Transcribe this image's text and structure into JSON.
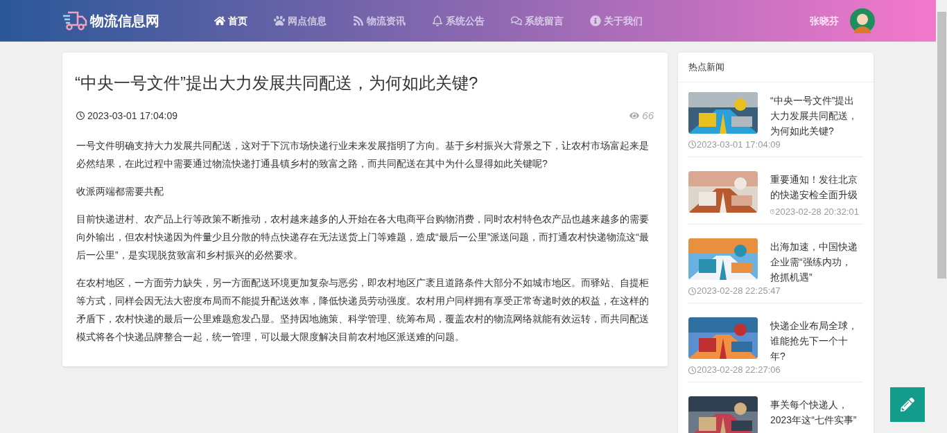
{
  "header": {
    "logo": "物流信息网",
    "nav": [
      {
        "label": "首页",
        "selected": true
      },
      {
        "label": "网点信息",
        "selected": false
      },
      {
        "label": "物流资讯",
        "selected": false
      },
      {
        "label": "系统公告",
        "selected": false
      },
      {
        "label": "系统留言",
        "selected": false
      },
      {
        "label": "关于我们",
        "selected": false
      }
    ],
    "user": "张晓芬"
  },
  "article": {
    "title": "“中央一号文件”提出大力发展共同配送，为何如此关键?",
    "date": "2023-03-01 17:04:09",
    "views": "66",
    "paragraphs": [
      "一号文件明确支持大力发展共同配送，这对于下沉市场快递行业未来发展指明了方向。基于乡村振兴大背景之下，让农村市场富起来是必然结果，在此过程中需要通过物流快递打通县镇乡村的致富之路，而共同配送在其中为什么显得如此关键呢?",
      "收派两端都需要共配",
      "目前快递进村、农产品上行等政策不断推动，农村越来越多的人开始在各大电商平台购物消费，同时农村特色农产品也越来越多的需要向外输出，但农村快递因为件量少且分散的特点快递存在无法送货上门等难题，造成“最后一公里”派送问题，而打通农村快递物流这“最后一公里”，是实现脱贫致富和乡村振兴的必然要求。",
      "在农村地区，一方面劳力缺失，另一方面配送环境更加复杂与恶劣，即农村地区广袤且道路条件大部分不如城市地区。而驿站、自提柜等方式，同样会因无法大密度布局而不能提升配送效率，降低快递员劳动强度。农村用户同样拥有享受正常寄递时效的权益，在这样的矛盾下，农村快递的最后一公里难题愈发凸显。坚持因地施策、科学管理、统筹布局，覆盖农村的物流网络就能有效运转，而共同配送模式将各个快递品牌整合一起，统一管理，可以最大限度解决目前农村地区派送难的问题。"
    ]
  },
  "hot_news": {
    "title": "热点新闻",
    "items": [
      {
        "title": "“中央一号文件”提出大力发展共同配送，为何如此关键?",
        "date": "2023-03-01 17:04:09",
        "kind": "date-below"
      },
      {
        "title": "重要通知！发往北京的快递安检全面升级",
        "date": "2023-02-28 20:32:01",
        "kind": "date-beside"
      },
      {
        "title": "出海加速，中国快递企业需“强练内功，抢抓机遇”",
        "date": "2023-02-28 22:25:47",
        "kind": "date-below"
      },
      {
        "title": "快递企业布局全球，谁能抢先下一个十年?",
        "date": "2023-02-28 22:27:06",
        "kind": "date-below"
      },
      {
        "title": "事关每个快递人，2023年这“七件实事”",
        "kind": "date-below"
      }
    ]
  }
}
